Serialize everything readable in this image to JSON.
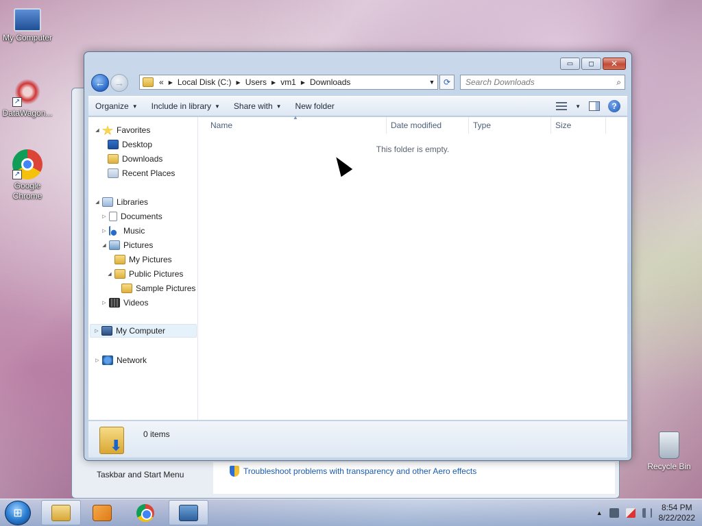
{
  "desktop": {
    "icons": [
      {
        "label": "My Computer"
      },
      {
        "label": "DataWagon..."
      },
      {
        "label": "Google Chrome"
      }
    ],
    "recycle_bin": "Recycle Bin"
  },
  "background_window": {
    "left_label": "Taskbar and Start Menu",
    "link": "Troubleshoot problems with transparency and other Aero effects"
  },
  "explorer": {
    "caption_buttons": {
      "minimize": "▭",
      "maximize": "◻",
      "close": "✕"
    },
    "address": {
      "overflow": "«",
      "crumbs": [
        "Local Disk (C:)",
        "Users",
        "vm1",
        "Downloads"
      ]
    },
    "search": {
      "placeholder": "Search Downloads"
    },
    "toolbar": {
      "organize": "Organize",
      "include_in_library": "Include in library",
      "share_with": "Share with",
      "new_folder": "New folder"
    },
    "nav": {
      "favorites": "Favorites",
      "desktop": "Desktop",
      "downloads": "Downloads",
      "recent_places": "Recent Places",
      "libraries": "Libraries",
      "documents": "Documents",
      "music": "Music",
      "pictures": "Pictures",
      "my_pictures": "My Pictures",
      "public_pictures": "Public Pictures",
      "sample_pictures": "Sample Pictures",
      "videos": "Videos",
      "my_computer": "My Computer",
      "network": "Network"
    },
    "columns": {
      "name": "Name",
      "date_modified": "Date modified",
      "type": "Type",
      "size": "Size"
    },
    "empty_message": "This folder is empty.",
    "details": {
      "item_count": "0 items"
    }
  },
  "taskbar": {
    "clock_time": "8:54 PM",
    "clock_date": "8/22/2022"
  }
}
